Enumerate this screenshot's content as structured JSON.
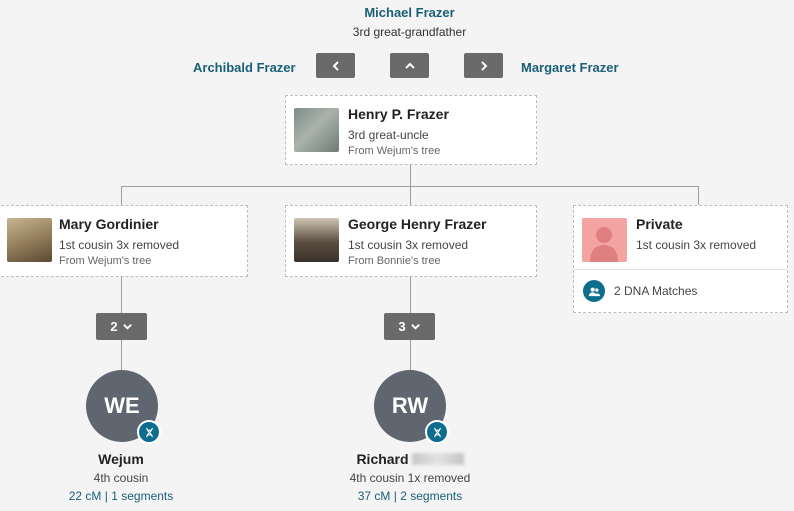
{
  "top_ancestor": {
    "name": "Michael Frazer",
    "relationship": "3rd great-grandfather"
  },
  "nav": {
    "left_label": "Archibald Frazer",
    "right_label": "Margaret Frazer"
  },
  "focus": {
    "name": "Henry P. Frazer",
    "relationship": "3rd great-uncle",
    "source": "From Wejum's tree"
  },
  "children": [
    {
      "name": "Mary Gordinier",
      "relationship": "1st cousin 3x removed",
      "source": "From Wejum's tree",
      "count": "2"
    },
    {
      "name": "George Henry Frazer",
      "relationship": "1st cousin 3x removed",
      "source": "From Bonnie's tree",
      "count": "3"
    },
    {
      "name": "Private",
      "relationship": "1st cousin 3x removed",
      "dna_matches": "2 DNA Matches"
    }
  ],
  "matches": [
    {
      "initials": "WE",
      "name": "Wejum",
      "relationship": "4th cousin",
      "cm": "22 cM",
      "sep": "|",
      "segments": "1 segments"
    },
    {
      "initials": "RW",
      "name": "Richard",
      "relationship": "4th cousin 1x removed",
      "cm": "37 cM",
      "sep": "|",
      "segments": "2 segments"
    }
  ],
  "colors": {
    "link": "#1a5f7a",
    "button": "#6a6a6a",
    "avatar": "#5f6670",
    "dna_badge": "#0e6d8e",
    "private_photo": "#f4a3a3"
  }
}
